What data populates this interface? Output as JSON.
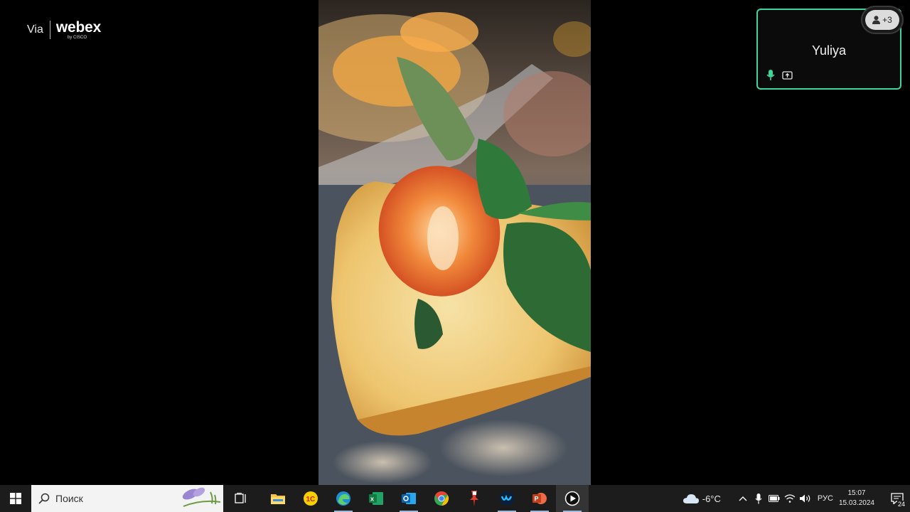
{
  "brand": {
    "via": "Via",
    "name": "webex",
    "by": "by CISCO"
  },
  "participant": {
    "name": "Yuliya",
    "extra_count": "+3"
  },
  "taskbar": {
    "search_placeholder": "Поиск",
    "apps": [
      "task-view",
      "file-explorer",
      "1c",
      "edge",
      "excel",
      "outlook",
      "chrome",
      "app-pin",
      "webex",
      "powerpoint",
      "media-player"
    ],
    "weather": "-6°C",
    "language": "РУС",
    "time": "15:07",
    "date": "15.03.2024",
    "notifications": "24"
  },
  "colors": {
    "tile_border": "#3fd69c",
    "taskbar": "#1c1c1c"
  }
}
